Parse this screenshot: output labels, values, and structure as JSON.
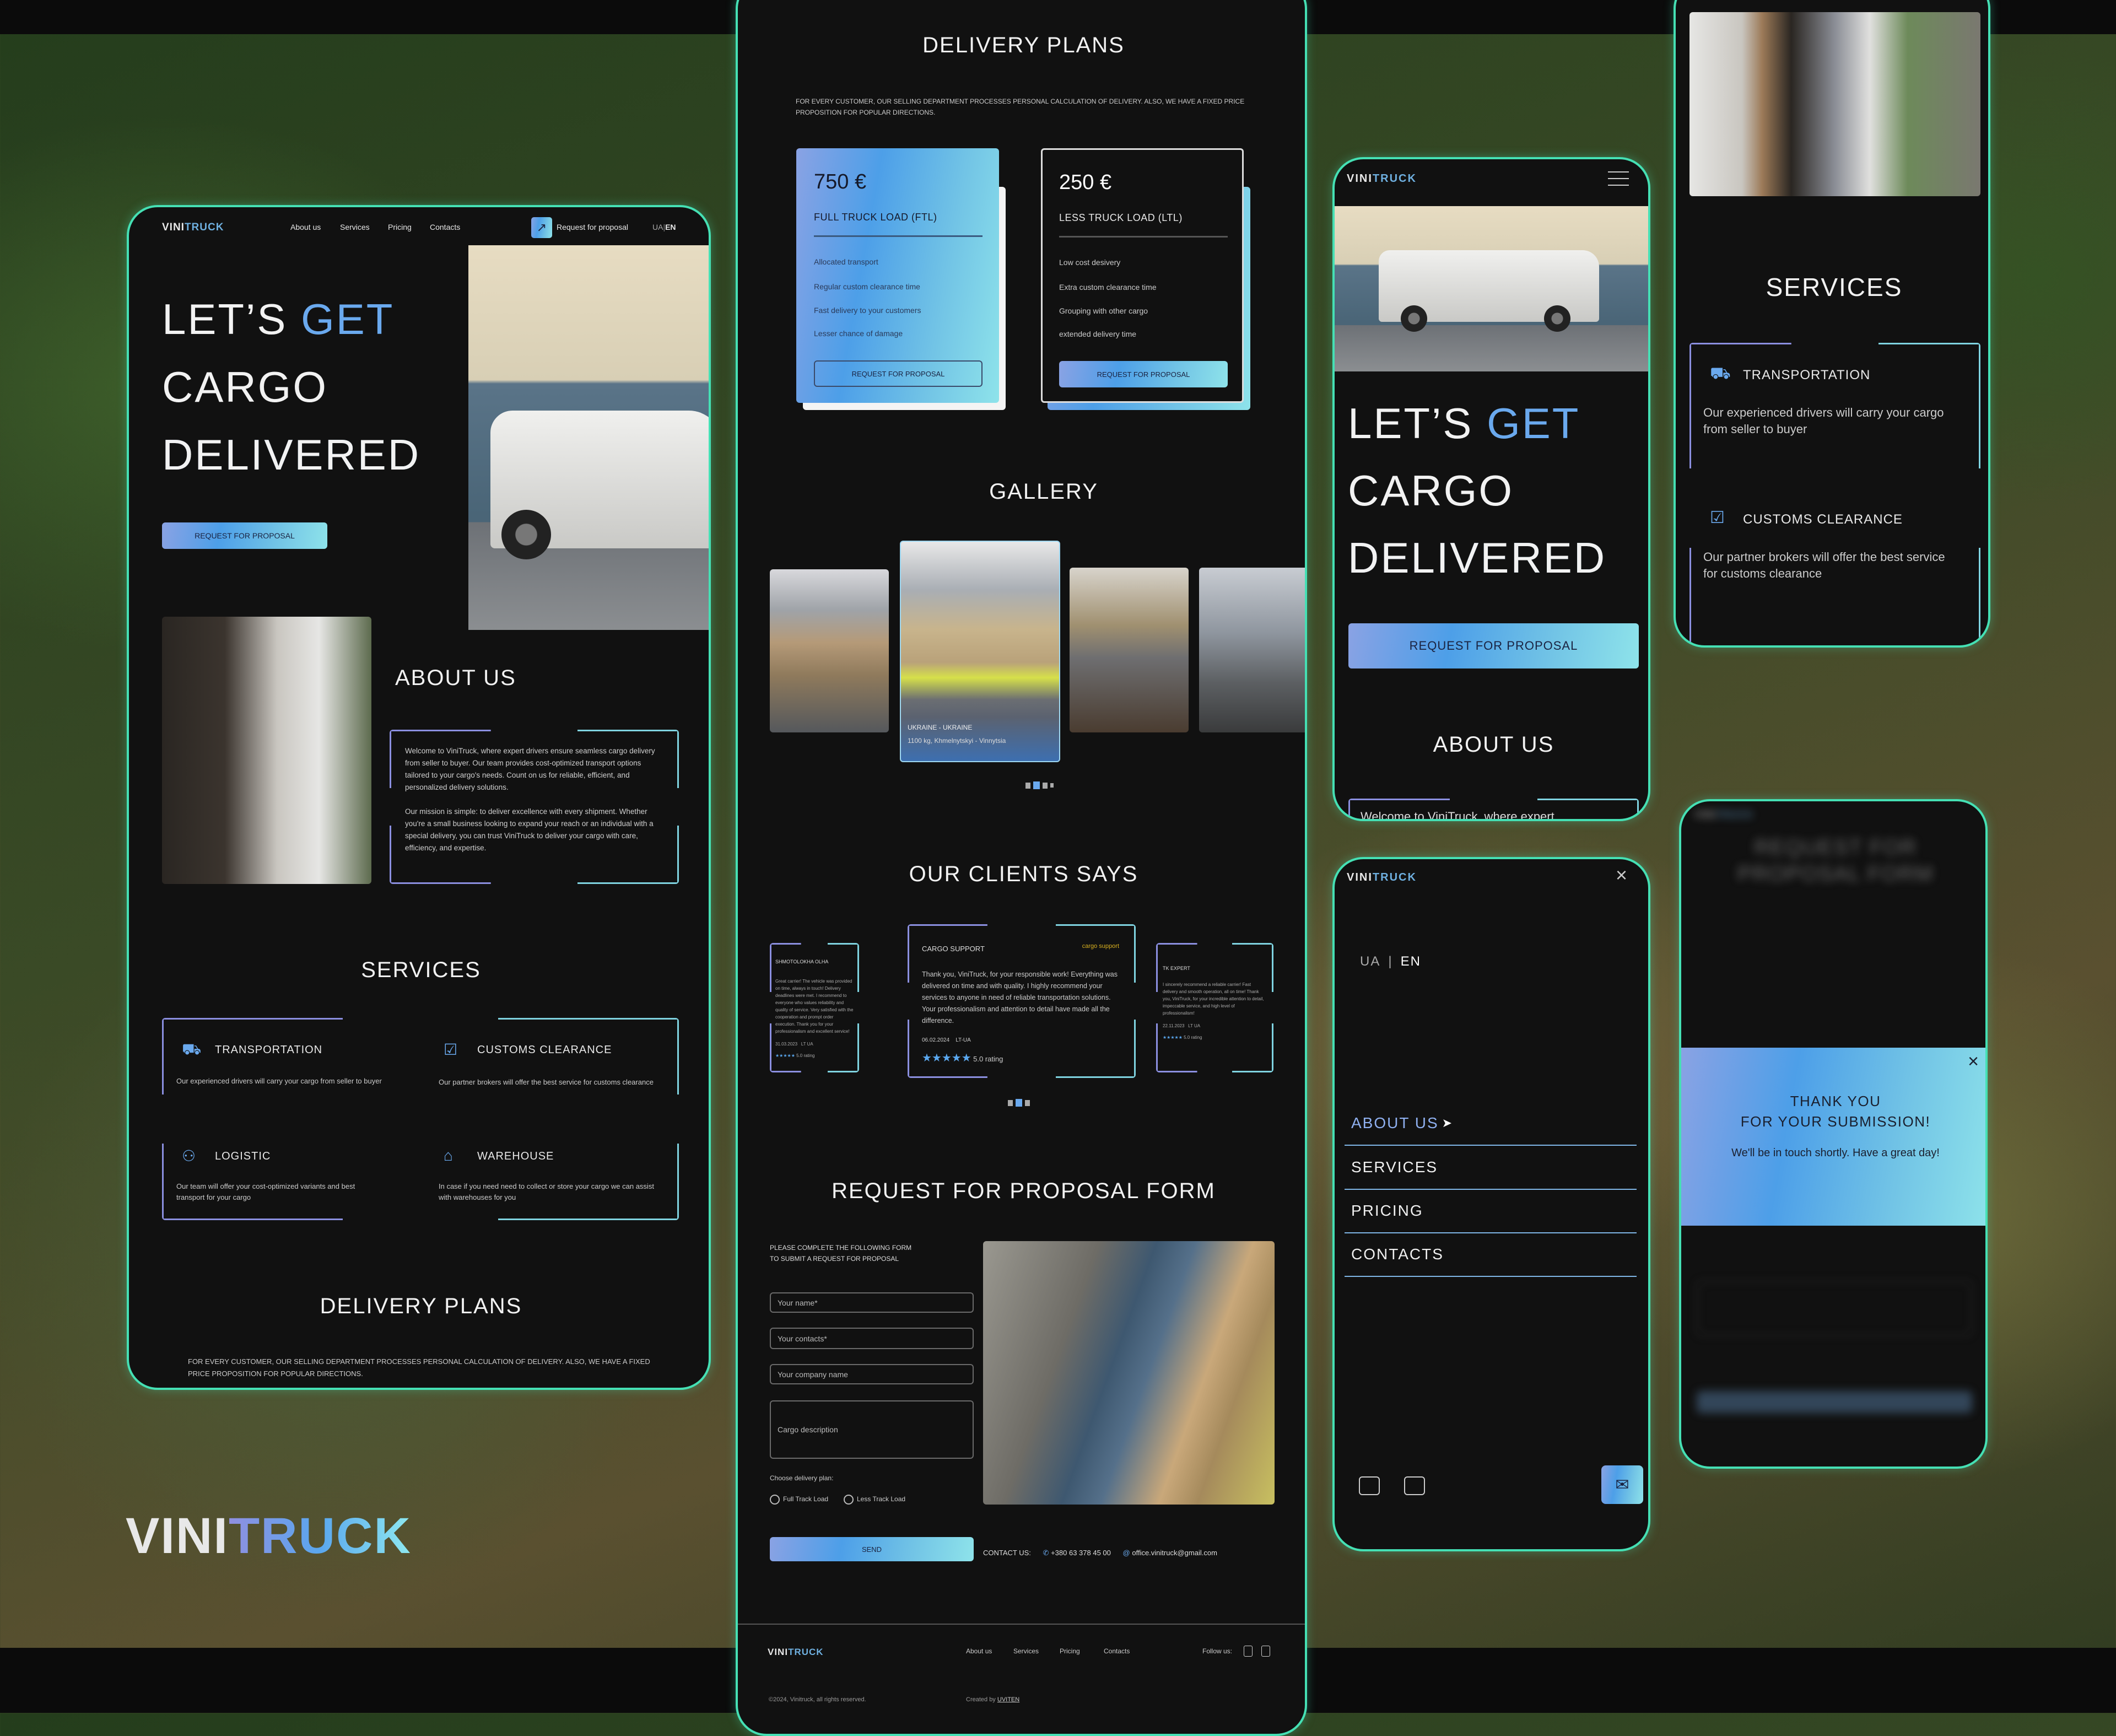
{
  "brand": {
    "part1": "VINI",
    "part2": "TRUCK"
  },
  "colors": {
    "accent_blue": "#5aa7ee",
    "accent_cyan": "#8ee3ea",
    "accent_purple": "#8b8fe0",
    "frame_border": "#45e0b4",
    "panel_bg": "#111111"
  },
  "nav": {
    "about": "About us",
    "services": "Services",
    "pricing": "Pricing",
    "contacts": "Contacts",
    "request": "Request for proposal",
    "lang_ua": "UA",
    "lang_en": "EN"
  },
  "hero": {
    "line1a": "LET’S ",
    "line1b": "GET",
    "line2": "CARGO",
    "line3": "DELIVERED",
    "cta": "REQUEST FOR PROPOSAL"
  },
  "about": {
    "title": "ABOUT US",
    "p1": "Welcome to ViniTruck, where expert drivers ensure seamless cargo delivery from seller to buyer. Our team provides cost-optimized transport options tailored to your cargo's needs. Count on us for reliable, efficient, and personalized delivery solutions.",
    "p2": "Our mission is simple: to deliver excellence with every shipment. Whether you're a small business looking to expand your reach or an individual with a special delivery, you can trust ViniTruck to deliver your cargo with care, efficiency, and expertise.",
    "mobile_preview": "Welcome to ViniTruck, where expert"
  },
  "services": {
    "title": "SERVICES",
    "items": [
      {
        "title": "TRANSPORTATION",
        "desc": "Our experienced drivers will carry your cargo from seller to buyer",
        "icon": "truck-icon"
      },
      {
        "title": "CUSTOMS CLEARANCE",
        "desc": "Our partner brokers will offer the best service for customs clearance",
        "icon": "customs-box-icon"
      },
      {
        "title": "LOGISTIC",
        "desc": "Our team will offer your cost-optimized variants and best transport for your cargo",
        "icon": "logistic-icon"
      },
      {
        "title": "WAREHOUSE",
        "desc": "In case if you need need to collect or store your cargo we can assist with warehouses for you",
        "icon": "warehouse-icon"
      }
    ]
  },
  "plans": {
    "title": "DELIVERY PLANS",
    "intro": "FOR EVERY CUSTOMER, OUR SELLING DEPARTMENT PROCESSES PERSONAL CALCULATION OF DELIVERY. ALSO, WE HAVE A FIXED PRICE PROPOSITION FOR POPULAR DIRECTIONS.",
    "cards": [
      {
        "price": "750 €",
        "name": "FULL TRUCK LOAD (FTL)",
        "features": [
          "Allocated transport",
          "Regular custom clearance time",
          "Fast delivery to your customers",
          "Lesser chance of damage"
        ],
        "button": "REQUEST FOR PROPOSAL"
      },
      {
        "price": "250 €",
        "name": "LESS TRUCK LOAD (LTL)",
        "features": [
          "Low cost desivery",
          "Extra custom clearance time",
          "Grouping with other cargo",
          "extended delivery time"
        ],
        "button": "REQUEST FOR PROPOSAL"
      }
    ]
  },
  "gallery": {
    "title": "GALLERY",
    "active_caption_title": "UKRAINE - UKRAINE",
    "active_caption_desc": "1100 kg, Khmelnytskyi - Vinnytsia",
    "pages": 4,
    "active_page": 2
  },
  "reviews": {
    "title": "OUR CLIENTS SAYS",
    "items": [
      {
        "name": "SHMOTOLOKHA OLHA",
        "text": "Great carrier! The vehicle was provided on time, always in touch! Delivery deadlines were met. I recommend to everyone who values reliability and quality of service. Very satisfied with the cooperation and prompt order execution. Thank you for your professionalism and excellent service!",
        "date": "31.03.2023",
        "route": "LT UA",
        "stars": "★★★★★",
        "rating": "5.0 rating"
      },
      {
        "name": "CARGO SUPPORT",
        "logo_text": "cargo support",
        "text": "Thank you, ViniTruck, for your responsible work! Everything was delivered on time and with quality. I highly recommend your services to anyone in need of reliable transportation solutions. Your professionalism and attention to detail have made all the difference.",
        "date": "06.02.2024",
        "route": "LT-UA",
        "stars": "★★★★★",
        "rating": "5.0 rating"
      },
      {
        "name": "TK EXPERT",
        "text": "I sincerely recommend a reliable carrier! Fast delivery and smooth operation, all on time! Thank you, ViniTruck, for your incredible attention to detail, impeccable service, and high level of professionalism!",
        "date": "22.11.2023",
        "route": "LT UA",
        "stars": "★★★★★",
        "rating": "5.0 rating"
      }
    ],
    "pages": 3,
    "active_page": 2
  },
  "form": {
    "title": "REQUEST FOR PROPOSAL FORM",
    "intro_1": "PLEASE COMPLETE THE FOLLOWING FORM",
    "intro_2": "TO SUBMIT A REQUEST FOR PROPOSAL",
    "name_placeholder": "Your name*",
    "contacts_placeholder": "Your contacts*",
    "company_placeholder": "Your company name",
    "cargo_placeholder": "Cargo description",
    "plan_label": "Choose delivery plan:",
    "plan_ftl": "Full Track Load",
    "plan_ltl": "Less Track Load",
    "send": "SEND",
    "contact_label": "CONTACT US:",
    "phone": "+380 63 378 45 00",
    "email": "office.vinitruck@gmail.com"
  },
  "footer": {
    "follow": "Follow us:",
    "copyright": "©2024, Vinitruck, all rights reserved.",
    "created_by": "Created by",
    "creator": "UVITEN"
  },
  "mobile_menu": {
    "items": [
      "ABOUT US",
      "SERVICES",
      "PRICING",
      "CONTACTS"
    ]
  },
  "thanks": {
    "line1": "THANK YOU",
    "line2": "FOR YOUR SUBMISSION!",
    "message": "We'll be in touch shortly. Have a great day!",
    "blurred_title": "REQUEST FOR PROPOSAL FORM"
  }
}
